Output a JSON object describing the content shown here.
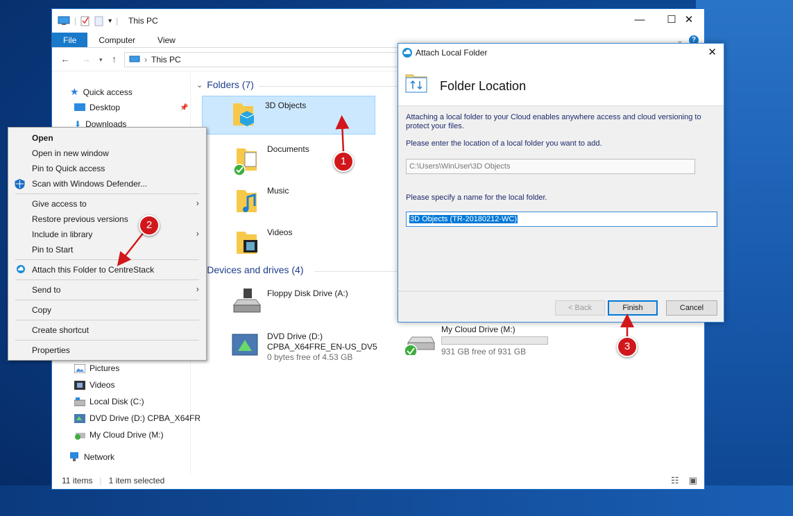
{
  "explorer": {
    "window_title": "This PC",
    "ribbon_tabs": [
      "File",
      "Computer",
      "View"
    ],
    "address": "This PC",
    "sidebar": {
      "quick_access": "Quick access",
      "desktop": "Desktop",
      "downloads": "Downloads",
      "pictures": "Pictures",
      "videos": "Videos",
      "local_disk": "Local Disk (C:)",
      "dvd_drive": "DVD Drive (D:) CPBA_X64FR",
      "cloud_drive": "My Cloud Drive (M:)",
      "network": "Network"
    },
    "folders_header": "Folders (7)",
    "folders": [
      "3D Objects",
      "Documents",
      "Music",
      "Videos"
    ],
    "devices_header": "Devices and drives (4)",
    "floppy": "Floppy Disk Drive (A:)",
    "dvd": {
      "name": "DVD Drive (D:)",
      "label": "CPBA_X64FRE_EN-US_DV5",
      "free": "0 bytes free of 4.53 GB"
    },
    "cloud": {
      "name": "My Cloud Drive (M:)",
      "free": "931 GB free of 931 GB",
      "used_fraction": 0
    },
    "status": {
      "items": "11 items",
      "selected": "1 item selected"
    }
  },
  "context_menu": {
    "items": [
      "Open",
      "Open in new window",
      "Pin to Quick access",
      "Scan with Windows Defender...",
      "Give access to",
      "Restore previous versions",
      "Include in library",
      "Pin to Start",
      "Attach this Folder to CentreStack",
      "Send to",
      "Copy",
      "Create shortcut",
      "Properties"
    ]
  },
  "dialog": {
    "title": "Attach Local Folder",
    "heading": "Folder Location",
    "desc": "Attaching a local folder to your Cloud enables anywhere access and cloud versioning to protect your files.",
    "location_prompt": "Please enter the location of a local folder you want to add.",
    "location_value": "C:\\Users\\WinUser\\3D Objects",
    "name_prompt": "Please specify a name for the local folder.",
    "name_value": "3D Objects (TR-20180212-WC)",
    "back": "< Back",
    "finish": "Finish",
    "cancel": "Cancel"
  },
  "callouts": [
    "1",
    "2",
    "3"
  ],
  "colors": {
    "accent": "#1979ca",
    "callout": "#d1171b",
    "selection": "#cce8ff"
  }
}
